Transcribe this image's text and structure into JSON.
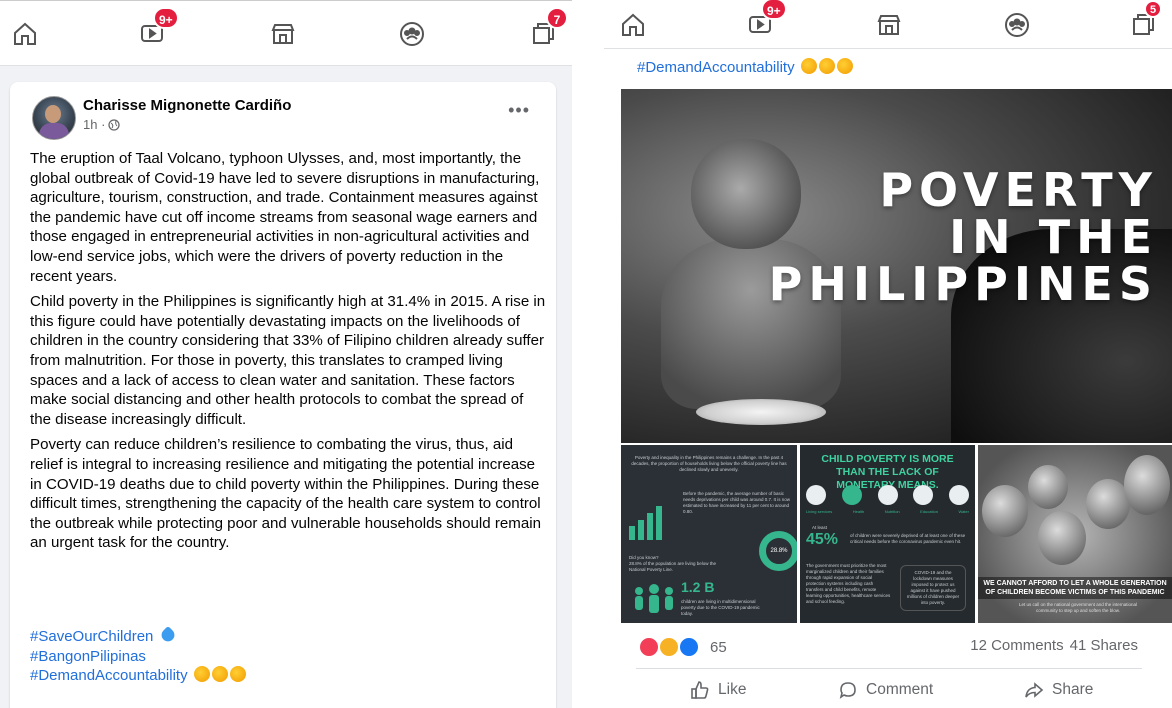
{
  "left": {
    "nav": {
      "watch_badge": "9+",
      "pages_badge": "7"
    },
    "post": {
      "author": "Charisse Mignonette Cardiño",
      "time": "1h ·",
      "paragraphs": [
        "The eruption of Taal Volcano, typhoon Ulysses, and, most importantly, the global outbreak of Covid-19 have led to severe disruptions in manufacturing, agriculture, tourism, construction, and trade. Containment measures against the pandemic have cut off income streams from seasonal wage earners and those engaged in entrepreneurial activities in non-agricultural activities and low-end service jobs, which were the drivers of poverty reduction in the recent years.",
        "Child poverty in the Philippines is significantly high at 31.4% in 2015. A rise in this figure could have potentially devastating impacts on the livelihoods of children in the country considering that 33% of Filipino children already suffer from malnutrition. For those in poverty, this translates to cramped living spaces and a lack of access to clean water and sanitation. These factors make social distancing and other health protocols to combat the spread of the disease increasingly difficult.",
        "Poverty can reduce children’s resilience to combating the virus, thus, aid relief is integral to increasing resilience and mitigating the potential increase in COVID-19 deaths due to child poverty within the Philippines. During these difficult times, strengthening the capacity of the health care system to control the outbreak while protecting poor and vulnerable households should remain an urgent task for the country."
      ],
      "hashtags": [
        "#SaveOurChildren",
        "#BangonPilipinas",
        "#DemandAccountability"
      ]
    }
  },
  "right": {
    "nav": {
      "watch_badge": "9+",
      "pages_badge": "5"
    },
    "hashtag": "#DemandAccountability",
    "main_image": {
      "title_lines": [
        "POVERTY",
        "IN THE",
        "PHILIPPINES"
      ]
    },
    "thumb1": {
      "intro": "Poverty and inequality in the Philippines remains a challenge. In the past 4 decades, the proportion of households living below the official poverty line has declined slowly and unevenly.",
      "note": "Before the pandemic, the average number of basic needs deprivations per child was around 0.7. It is now estimated to have increased by 11 per cent to around 0.80.",
      "did_you_know": "Did you know?\n28.8% of the population are living below the National Poverty Line.",
      "donut_label": "28.8%",
      "big_number": "1.2 B",
      "big_caption": "children are living in multidimensional poverty due to the COVID-19 pandemic today."
    },
    "thumb2": {
      "title": "CHILD POVERTY IS MORE THAN THE LACK OF MONETARY MEANS.",
      "icon_labels": [
        "Living services",
        "Health",
        "Nutrition",
        "Education",
        "Water"
      ],
      "at_least": "At least",
      "percent": "45%",
      "percent_caption": "of children were severely deprived of at least one of these critical needs before the coronavirus pandemic even hit.",
      "body": "The government must prioritize the most marginalized children and their families through rapid expansion of social protection systems including cash transfers and child benefits, remote learning opportunities, healthcare services and school feeding.",
      "quote": "COVID-19 and the lockdown measures imposed to protect us against it have pushed millions of children deeper into poverty."
    },
    "thumb3": {
      "caption": "WE CANNOT AFFORD TO LET A WHOLE GENERATION OF CHILDREN BECOME VICTIMS OF THIS PANDEMIC",
      "sub": "Let us call on the national government and the international community to step up and soften the blow."
    },
    "footer": {
      "reaction_count": "65",
      "comments": "12 Comments",
      "shares": "41 Shares",
      "like": "Like",
      "comment": "Comment",
      "share": "Share"
    }
  },
  "colors": {
    "link": "#216fdb",
    "badge": "#e41e3f",
    "accent_green": "#35b68c"
  }
}
